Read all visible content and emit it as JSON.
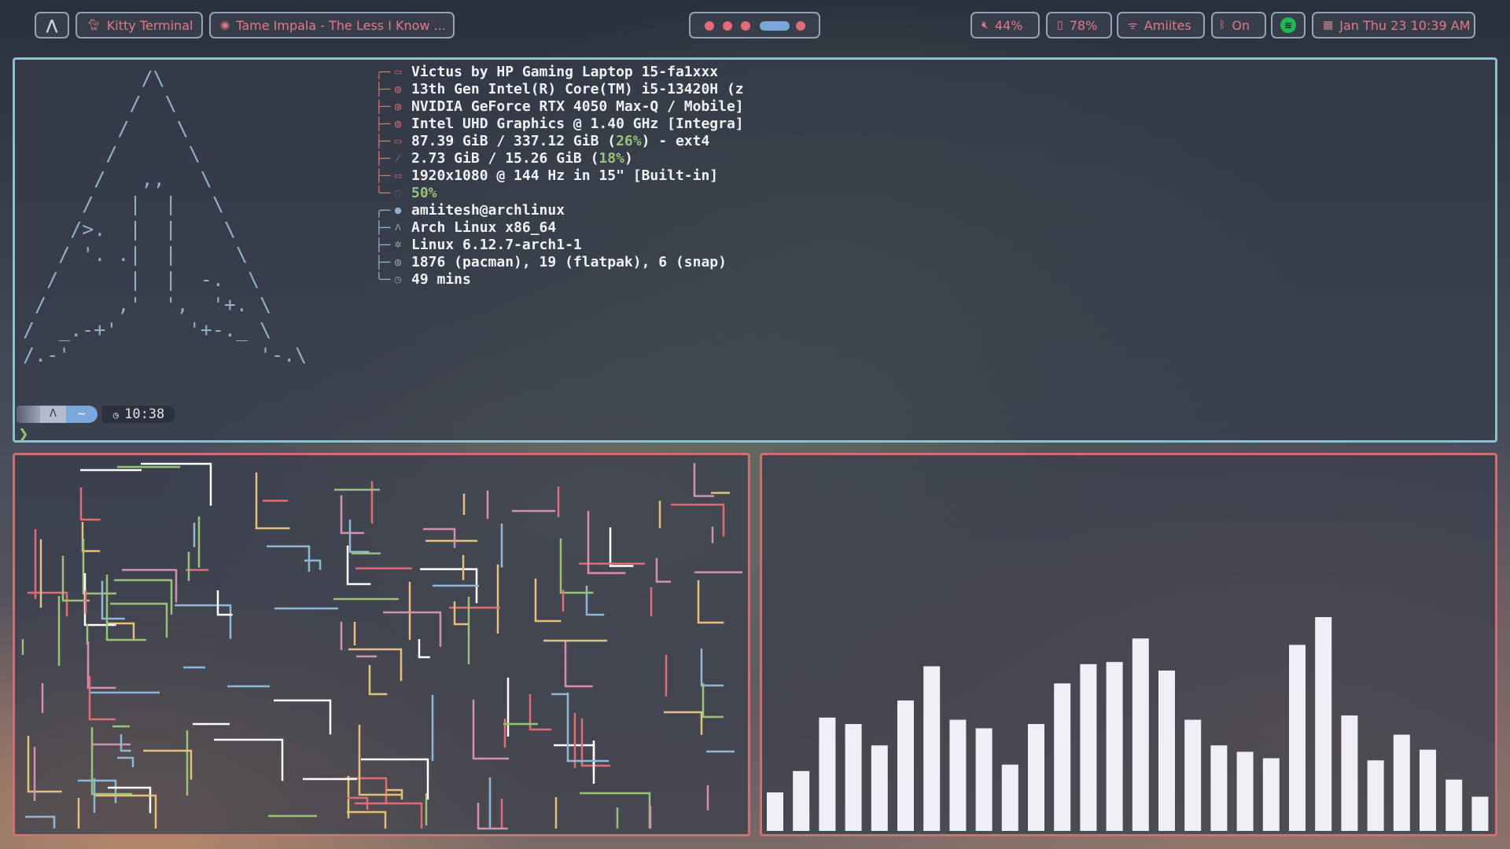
{
  "topbar": {
    "launcher_icon": "arch-logo-icon",
    "active_window": "Kitty Terminal",
    "media": "Tame Impala - The Less I Know ...",
    "volume": "44%",
    "battery": "78%",
    "wifi": "Amiites",
    "bluetooth": "On",
    "datetime": "Jan Thu 23  10:39 AM"
  },
  "workspaces": {
    "count": 5,
    "active_index": 3,
    "colors": {
      "dot": "#e06c75",
      "active": "#7aa6da"
    }
  },
  "fetch": {
    "ascii": [
      "          /\\",
      "         /  \\",
      "        /    \\",
      "       /      \\",
      "      /   ,,   \\",
      "     /   |  |   \\",
      "    />.  |  |    \\",
      "   / '. .|  |     \\",
      "  /      |  |  -.  \\",
      " /      ,'  ',  '+. \\",
      "/  _.-+'      '+-._ \\",
      "/.-'                '-.\\"
    ],
    "hardware": [
      {
        "icon": "laptop-icon",
        "text": "Victus by HP Gaming Laptop 15-fa1xxx"
      },
      {
        "icon": "cpu-icon",
        "text": "13th Gen Intel(R) Core(TM) i5-13420H (z"
      },
      {
        "icon": "gpu-icon",
        "text": "NVIDIA GeForce RTX 4050 Max-Q / Mobile]"
      },
      {
        "icon": "gpu-icon",
        "text": "Intel UHD Graphics @ 1.40 GHz [Integra]"
      },
      {
        "icon": "disk-icon",
        "text": "87.39 GiB / 337.12 GiB (",
        "hl": "26%",
        "tail": ") - ext4"
      },
      {
        "icon": "memory-icon",
        "text": "2.73 GiB / 15.26 GiB (",
        "hl": "18%",
        "tail": ")"
      },
      {
        "icon": "display-icon",
        "text": "1920x1080 @ 144 Hz in 15\" [Built-in]"
      },
      {
        "icon": "battery-icon",
        "text": "",
        "hl": "50%",
        "tail": ""
      }
    ],
    "software": [
      {
        "icon": "user-icon",
        "text": "amiitesh@archlinux"
      },
      {
        "icon": "arch-icon",
        "text": "Arch Linux x86_64"
      },
      {
        "icon": "kernel-icon",
        "text": "Linux 6.12.7-arch1-1"
      },
      {
        "icon": "package-icon",
        "text": "1876 (pacman), 19 (flatpak), 6 (snap)"
      },
      {
        "icon": "clock-icon",
        "text": "49 mins"
      }
    ]
  },
  "prompt": {
    "os_glyph": "Λ",
    "dir": "~",
    "time": "10:38",
    "cursor": "❯"
  },
  "visualizer": {
    "levels": [
      0.18,
      0.28,
      0.53,
      0.5,
      0.4,
      0.61,
      0.77,
      0.52,
      0.48,
      0.31,
      0.5,
      0.69,
      0.78,
      0.79,
      0.9,
      0.75,
      0.52,
      0.4,
      0.37,
      0.34,
      0.87,
      1.0,
      0.54,
      0.33,
      0.45,
      0.38,
      0.24,
      0.16
    ],
    "color": "#eef0f6"
  },
  "pipes": {
    "colors": [
      "#e06c75",
      "#8fb8d8",
      "#e5c07b",
      "#98c379",
      "#d391b0",
      "#ffffff"
    ]
  }
}
